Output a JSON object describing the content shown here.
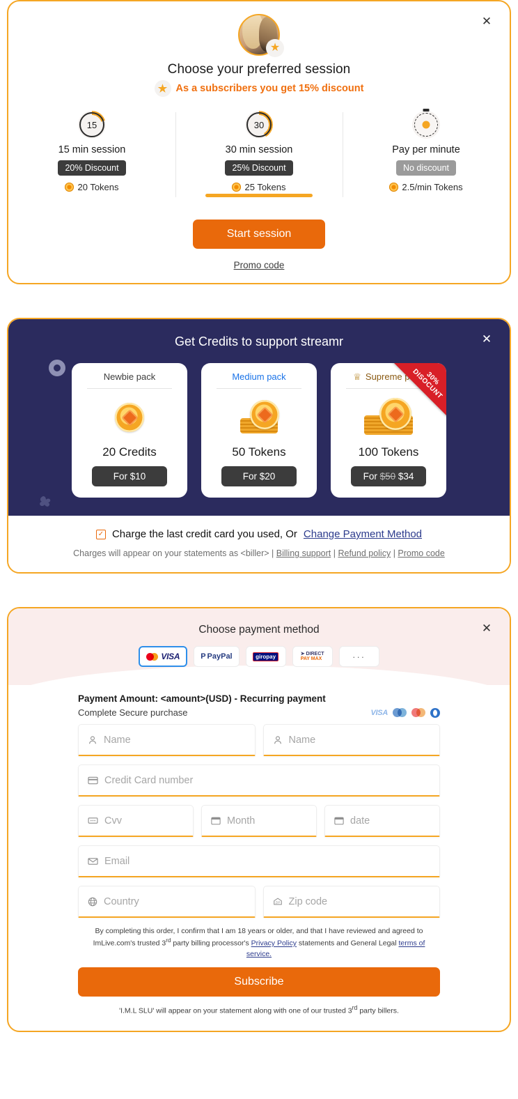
{
  "session_panel": {
    "close_label": "✕",
    "avatar_name": "streamer-avatar",
    "title": "Choose your preferred session",
    "subtitle": "As a subscribers you get 15% discount",
    "options": [
      {
        "timer_label": "15",
        "name": "15 min session",
        "discount": "20% Discount",
        "tokens": "20 Tokens",
        "selected": false
      },
      {
        "timer_label": "30",
        "name": "30 min session",
        "discount": "25% Discount",
        "tokens": "25 Tokens",
        "selected": true
      },
      {
        "timer_label": "",
        "name": "Pay per minute",
        "discount": "No discount",
        "tokens": "2.5/min Tokens",
        "selected": false
      }
    ],
    "start_button": "Start session",
    "promo_link": "Promo code",
    "accent_color": "#F5A623",
    "button_color": "#E9690B",
    "subtitle_color": "#F07010"
  },
  "credits_panel": {
    "close_label": "✕",
    "title": "Get Credits to support streamr",
    "background_color": "#2B2B5E",
    "packs": [
      {
        "name": "Newbie pack",
        "amount": "20 Credits",
        "price_prefix": "For ",
        "price_old": "",
        "price": "$10",
        "ribbon": "",
        "crown": false
      },
      {
        "name": "Medium pack",
        "amount": "50 Tokens",
        "price_prefix": "For ",
        "price_old": "",
        "price": "$20",
        "ribbon": "",
        "crown": false
      },
      {
        "name": "Supreme pack",
        "amount": "100 Tokens",
        "price_prefix": "For ",
        "price_old": "$50",
        "price": "$34",
        "ribbon_line1": "30%",
        "ribbon_line2": "DISOCUNT",
        "crown": true
      }
    ],
    "charge_text": "Charge the last credit card you used, Or",
    "change_payment_link": "Change Payment Method",
    "charges_note_prefix": "Charges will appear on your statements as <biller> | ",
    "charges_links": [
      "Billing support",
      "Refund policy",
      "Promo code"
    ]
  },
  "payment_panel": {
    "close_label": "✕",
    "head_title": "Choose payment method",
    "methods": [
      {
        "id": "card",
        "label": "VISA",
        "selected": true
      },
      {
        "id": "paypal",
        "label": "PayPal",
        "selected": false
      },
      {
        "id": "giropay",
        "label": "giropay",
        "selected": false
      },
      {
        "id": "directpaymax",
        "label": "DIRECT PAY MAX",
        "selected": false
      },
      {
        "id": "more",
        "label": "···",
        "selected": false
      }
    ],
    "amount_line": "Payment Amount: <amount>(USD) - Recurring payment",
    "secure_text": "Complete Secure purchase",
    "card_brands": [
      "VISA",
      "Maestro",
      "MasterCard",
      "Diners"
    ],
    "fields": {
      "first_name": {
        "placeholder": "Name",
        "value": "",
        "icon": "person-icon"
      },
      "last_name": {
        "placeholder": "Name",
        "value": "",
        "icon": "person-icon"
      },
      "card_number": {
        "placeholder": "Credit Card number",
        "value": "",
        "icon": "card-icon"
      },
      "cvv": {
        "placeholder": "Cvv",
        "value": "",
        "icon": "cvv-icon"
      },
      "month": {
        "placeholder": "Month",
        "value": "",
        "icon": "calendar-icon"
      },
      "date": {
        "placeholder": "date",
        "value": "",
        "icon": "calendar-icon"
      },
      "email": {
        "placeholder": "Email",
        "value": "",
        "icon": "envelope-icon"
      },
      "country": {
        "placeholder": "Country",
        "value": "",
        "icon": "globe-icon"
      },
      "zip": {
        "placeholder": "Zip code",
        "value": "",
        "icon": "zip-icon"
      }
    },
    "legal_part1": "By completing this order, I confirm that I am 18 years or older, and that I have reviewed and agreed to ImLive.com's trusted 3",
    "legal_sup1": "rd",
    "legal_part2": " party billing processor's ",
    "legal_link1": "Privacy Policy",
    "legal_part3": " statements and General Legal ",
    "legal_link2": "terms of service.",
    "subscribe_button": "Subscribe",
    "biller_note_part1": "'I.M.L SLU' will appear on your statement along with one of our trusted 3",
    "biller_note_sup": "rd",
    "biller_note_part2": " party billers."
  }
}
